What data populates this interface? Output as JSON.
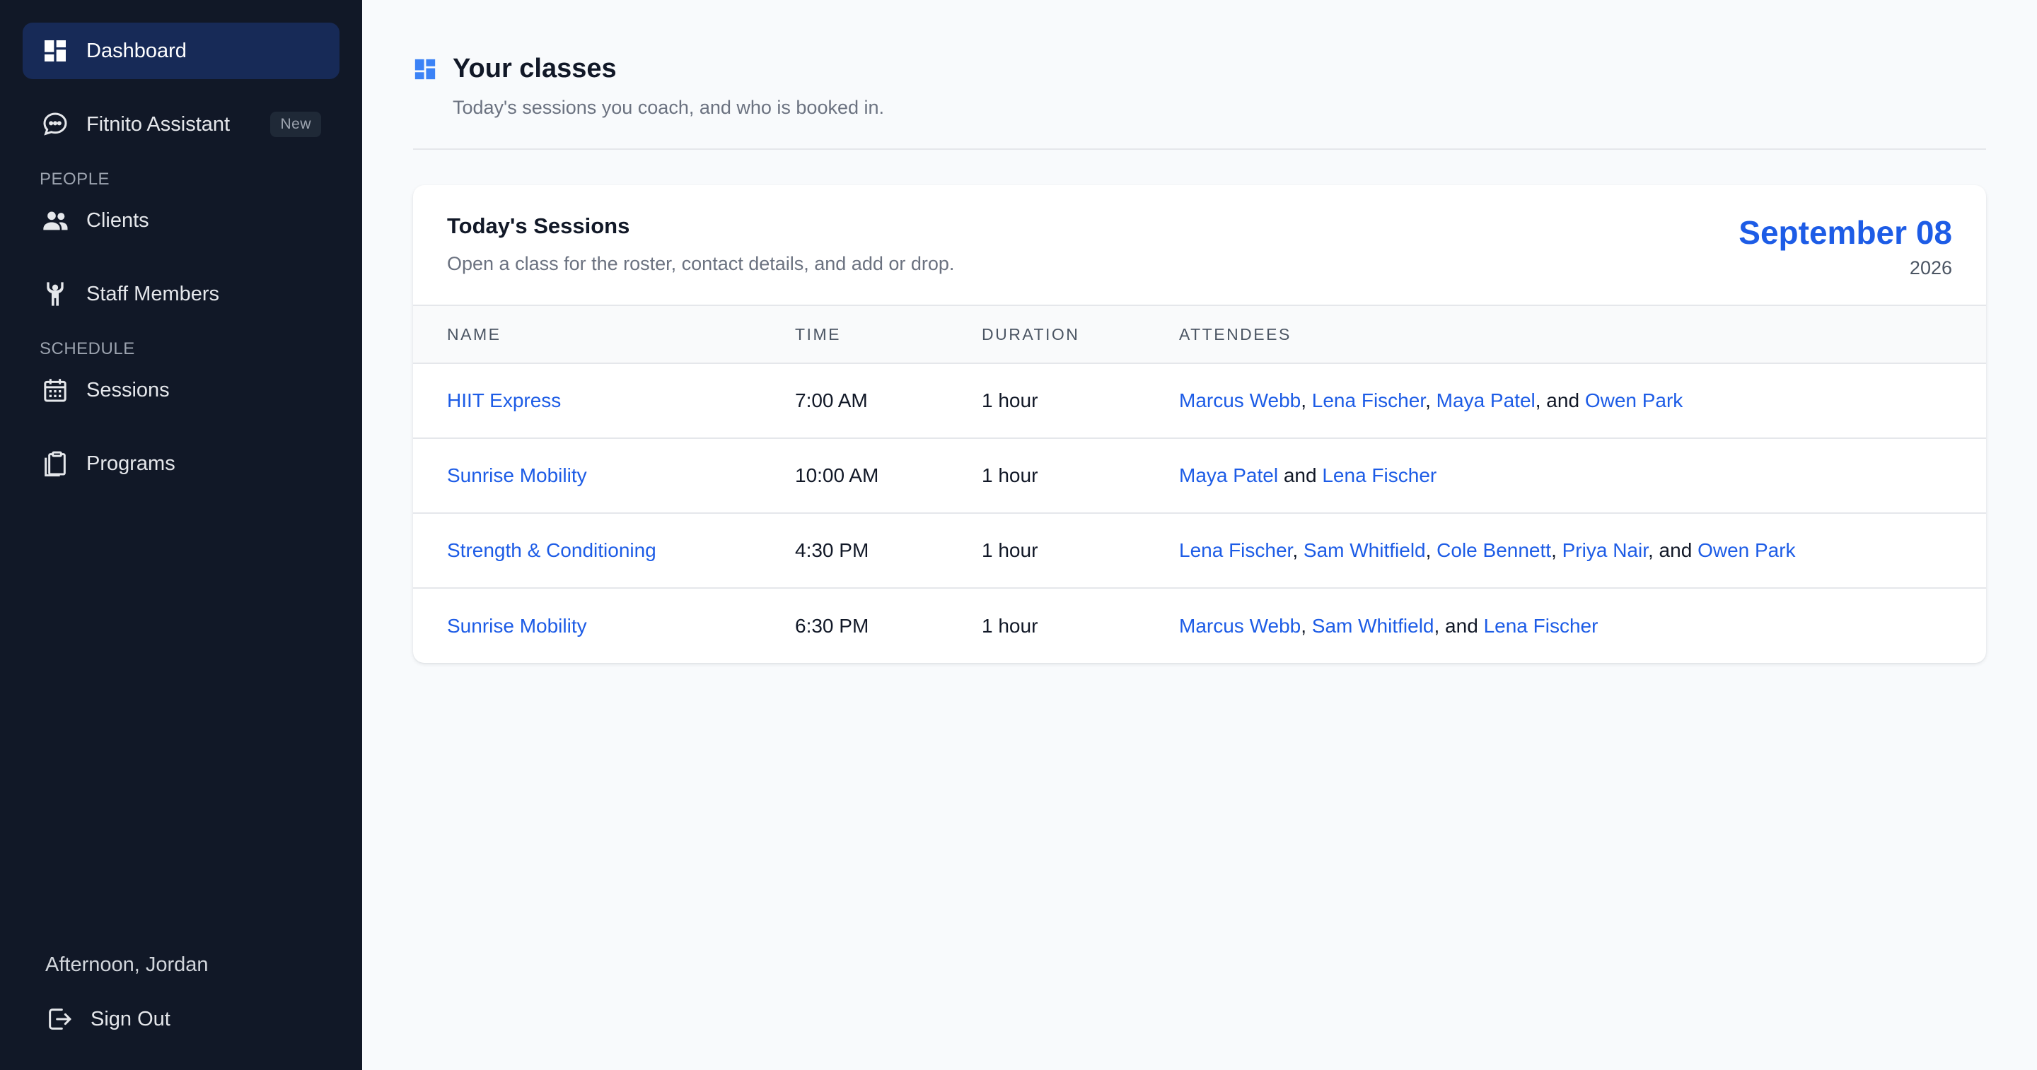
{
  "sidebar": {
    "nav_top": [
      {
        "label": "Dashboard",
        "icon": "dashboard-icon",
        "active": true
      },
      {
        "label": "Fitnito Assistant",
        "icon": "chat-bubble-icon",
        "badge": "New"
      }
    ],
    "people_label": "PEOPLE",
    "people_items": [
      {
        "label": "Clients",
        "icon": "users-icon"
      },
      {
        "label": "Staff Members",
        "icon": "person-arms-up-icon"
      }
    ],
    "schedule_label": "SCHEDULE",
    "schedule_items": [
      {
        "label": "Sessions",
        "icon": "calendar-icon"
      },
      {
        "label": "Programs",
        "icon": "clipboard-icon"
      }
    ],
    "greeting": "Afternoon, Jordan",
    "sign_out": "Sign Out"
  },
  "header": {
    "title": "Your classes",
    "subtitle": "Today's sessions you coach, and who is booked in."
  },
  "sessions_card": {
    "title": "Today's Sessions",
    "subtitle": "Open a class for the roster, contact details, and add or drop.",
    "date_main": "September 08",
    "date_year": "2026",
    "columns": [
      "NAME",
      "TIME",
      "DURATION",
      "ATTENDEES"
    ],
    "rows": [
      {
        "name": "HIIT Express",
        "time": "7:00 AM",
        "duration": "1 hour",
        "attendees": [
          "Marcus Webb",
          "Lena Fischer",
          "Maya Patel",
          "Owen Park"
        ]
      },
      {
        "name": "Sunrise Mobility",
        "time": "10:00 AM",
        "duration": "1 hour",
        "attendees": [
          "Maya Patel",
          "Lena Fischer"
        ]
      },
      {
        "name": "Strength & Conditioning",
        "time": "4:30 PM",
        "duration": "1 hour",
        "attendees": [
          "Lena Fischer",
          "Sam Whitfield",
          "Cole Bennett",
          "Priya Nair",
          "Owen Park"
        ]
      },
      {
        "name": "Sunrise Mobility",
        "time": "6:30 PM",
        "duration": "1 hour",
        "attendees": [
          "Marcus Webb",
          "Sam Whitfield",
          "Lena Fischer"
        ]
      }
    ]
  },
  "colors": {
    "sidebar_bg": "#111827",
    "active_nav_bg": "#172a57",
    "accent": "#1d5ce6",
    "page_bg": "#f8fafc"
  }
}
